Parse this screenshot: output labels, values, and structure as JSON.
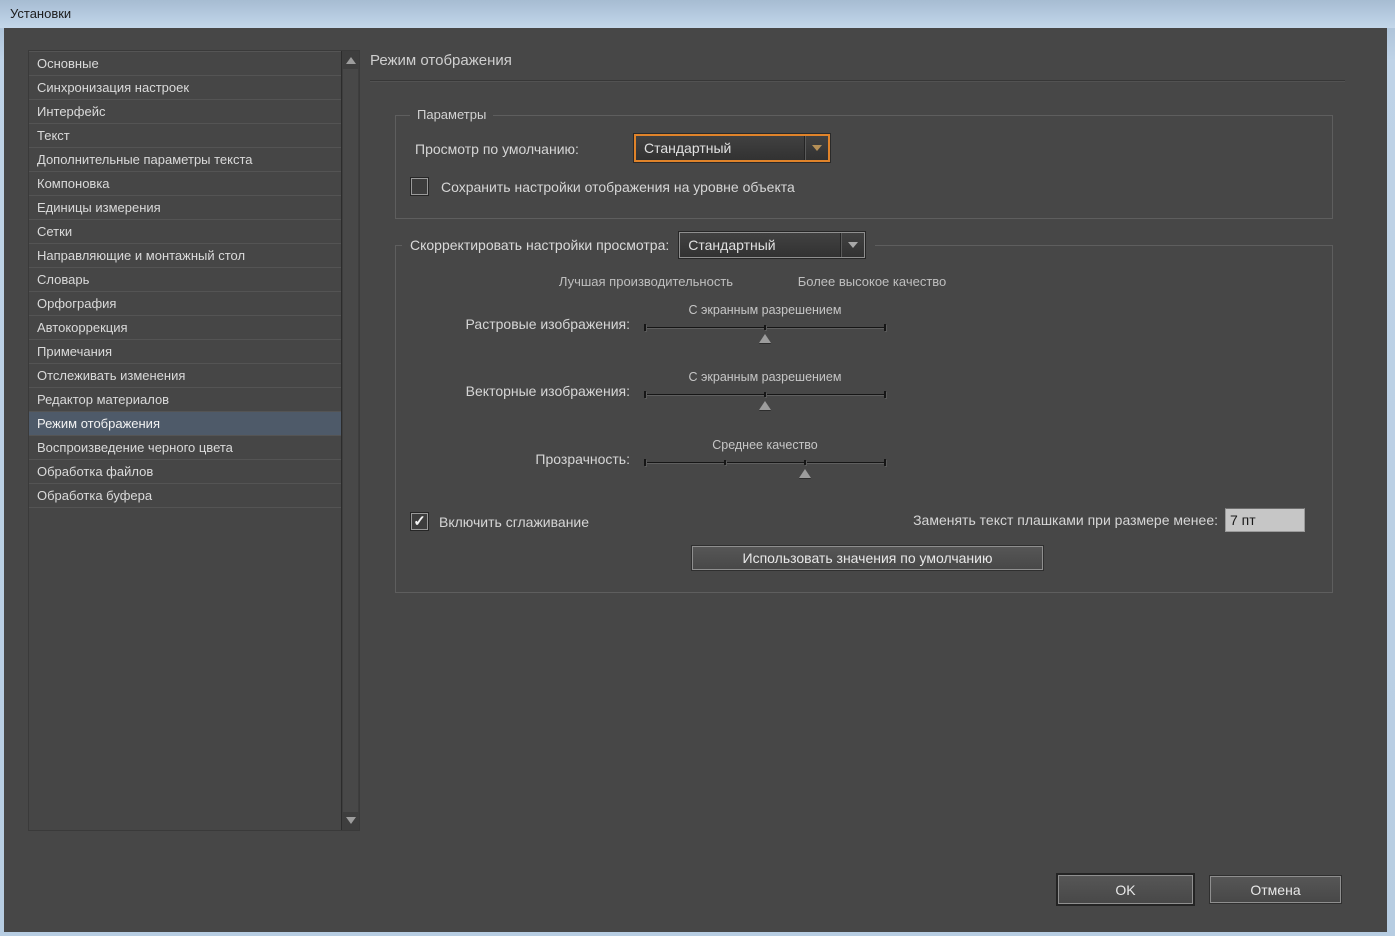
{
  "window": {
    "title": "Установки"
  },
  "sidebar": {
    "items": [
      {
        "label": "Основные",
        "selected": false
      },
      {
        "label": "Синхронизация настроек",
        "selected": false
      },
      {
        "label": "Интерфейс",
        "selected": false
      },
      {
        "label": "Текст",
        "selected": false
      },
      {
        "label": "Дополнительные параметры текста",
        "selected": false
      },
      {
        "label": "Компоновка",
        "selected": false
      },
      {
        "label": "Единицы измерения",
        "selected": false
      },
      {
        "label": "Сетки",
        "selected": false
      },
      {
        "label": "Направляющие и монтажный стол",
        "selected": false
      },
      {
        "label": "Словарь",
        "selected": false
      },
      {
        "label": "Орфография",
        "selected": false
      },
      {
        "label": "Автокоррекция",
        "selected": false
      },
      {
        "label": "Примечания",
        "selected": false
      },
      {
        "label": "Отслеживать изменения",
        "selected": false
      },
      {
        "label": "Редактор материалов",
        "selected": false
      },
      {
        "label": "Режим отображения",
        "selected": true
      },
      {
        "label": "Воспроизведение черного цвета",
        "selected": false
      },
      {
        "label": "Обработка файлов",
        "selected": false
      },
      {
        "label": "Обработка буфера",
        "selected": false
      }
    ]
  },
  "main": {
    "title": "Режим отображения",
    "params_group": {
      "legend": "Параметры",
      "default_view_label": "Просмотр по умолчанию:",
      "default_view_value": "Стандартный",
      "preserve_checkbox_label": "Сохранить настройки отображения на уровне объекта",
      "preserve_checkbox_checked": false
    },
    "adjust_group": {
      "legend": "Скорректировать настройки просмотра:",
      "view_value": "Стандартный",
      "perf_header": "Лучшая производительность",
      "quality_header": "Более высокое качество",
      "sliders": [
        {
          "label": "Растровые изображения:",
          "value_label": "С экранным разрешением",
          "position": 50,
          "ticks": [
            50
          ]
        },
        {
          "label": "Векторные изображения:",
          "value_label": "С экранным разрешением",
          "position": 50,
          "ticks": [
            50
          ]
        },
        {
          "label": "Прозрачность:",
          "value_label": "Среднее качество",
          "position": 66.7,
          "ticks": [
            33.3,
            66.7
          ]
        }
      ],
      "antialias_checkbox_label": "Включить сглаживание",
      "antialias_checkbox_checked": true,
      "greek_label": "Заменять текст плашками при размере менее:",
      "greek_value": "7 пт",
      "defaults_button": "Использовать значения по умолчанию"
    }
  },
  "footer": {
    "ok": "OK",
    "cancel": "Отмена"
  },
  "colors": {
    "client_bg": "#474747",
    "selection_bg": "#4e5a69",
    "focus_accent": "#e0832a",
    "titlebar_top": "#a6bcd2",
    "titlebar_bottom": "#c4d7ea"
  }
}
